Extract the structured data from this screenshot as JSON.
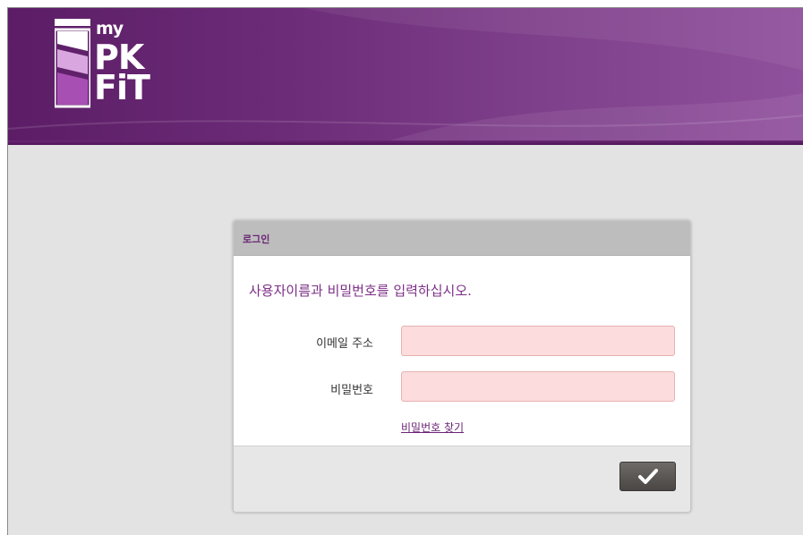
{
  "brand": {
    "logo_line1": "my",
    "logo_line2": "PK",
    "logo_line3": "FiT",
    "primary_color": "#6a2574",
    "header_color": "#6c2c78"
  },
  "login_dialog": {
    "title": "로그인",
    "instruction": "사용자이름과 비밀번호를 입력하십시오.",
    "email_label": "이메일 주소",
    "email_value": "",
    "password_label": "비밀번호",
    "password_value": "",
    "forgot_password_label": "비밀번호 찾기",
    "submit_icon": "checkmark-icon",
    "input_background": "#fcdcdc"
  }
}
